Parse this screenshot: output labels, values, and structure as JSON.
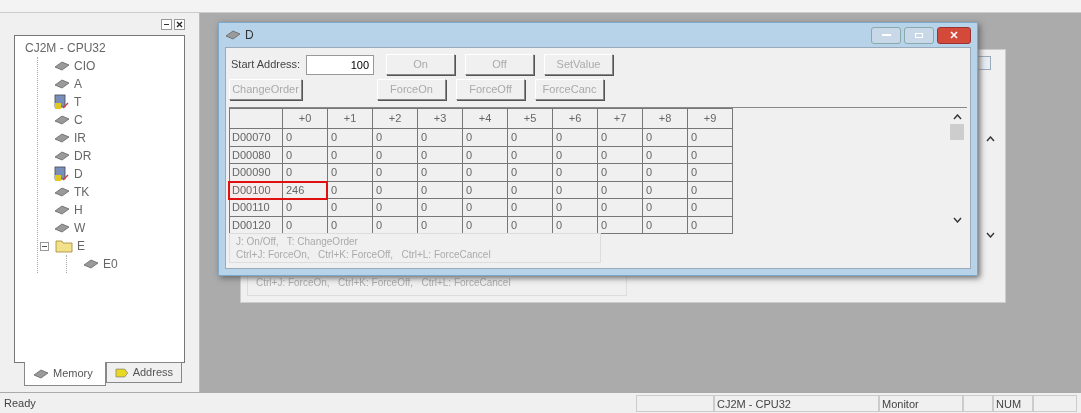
{
  "tree": {
    "label": "CJ2M - CPU32",
    "children": [
      {
        "label": "CIO",
        "kind": "area"
      },
      {
        "label": "A",
        "kind": "area"
      },
      {
        "label": "T",
        "kind": "table"
      },
      {
        "label": "C",
        "kind": "area"
      },
      {
        "label": "IR",
        "kind": "area"
      },
      {
        "label": "DR",
        "kind": "area"
      },
      {
        "label": "D",
        "kind": "table"
      },
      {
        "label": "TK",
        "kind": "area"
      },
      {
        "label": "H",
        "kind": "area"
      },
      {
        "label": "W",
        "kind": "area"
      },
      {
        "label": "E",
        "kind": "folder",
        "expanded": true,
        "children": [
          {
            "label": "E0",
            "kind": "area"
          }
        ]
      }
    ]
  },
  "pane_tabs": [
    {
      "label": "Memory",
      "selected": true
    },
    {
      "label": "Address",
      "selected": false
    }
  ],
  "back_window": {
    "hint": "Ctrl+J: ForceOn,   Ctrl+K: ForceOff,   Ctrl+L: ForceCancel"
  },
  "window": {
    "title": "D",
    "start_address_label": "Start Address:",
    "start_address": "100",
    "buttons_row_1": [
      {
        "label": "On",
        "disabled": true
      },
      {
        "label": "Off",
        "disabled": true
      },
      {
        "label": "SetValue",
        "disabled": true
      }
    ],
    "change_order": {
      "label": "ChangeOrder",
      "disabled": true
    },
    "buttons_row_2": [
      {
        "label": "ForceOn",
        "disabled": true
      },
      {
        "label": "ForceOff",
        "disabled": true
      },
      {
        "label": "ForceCanc",
        "disabled": true
      }
    ],
    "table": {
      "columns": [
        "+0",
        "+1",
        "+2",
        "+3",
        "+4",
        "+5",
        "+6",
        "+7",
        "+8",
        "+9"
      ],
      "rows": [
        {
          "address": "D00070",
          "highlighted": false,
          "values": [
            "0",
            "0",
            "0",
            "0",
            "0",
            "0",
            "0",
            "0",
            "0",
            "0"
          ]
        },
        {
          "address": "D00080",
          "highlighted": false,
          "values": [
            "0",
            "0",
            "0",
            "0",
            "0",
            "0",
            "0",
            "0",
            "0",
            "0"
          ]
        },
        {
          "address": "D00090",
          "highlighted": false,
          "values": [
            "0",
            "0",
            "0",
            "0",
            "0",
            "0",
            "0",
            "0",
            "0",
            "0"
          ]
        },
        {
          "address": "D00100",
          "highlighted": true,
          "values": [
            "246",
            "0",
            "0",
            "0",
            "0",
            "0",
            "0",
            "0",
            "0",
            "0"
          ]
        },
        {
          "address": "D00110",
          "highlighted": false,
          "values": [
            "0",
            "0",
            "0",
            "0",
            "0",
            "0",
            "0",
            "0",
            "0",
            "0"
          ]
        },
        {
          "address": "D00120",
          "highlighted": false,
          "values": [
            "0",
            "0",
            "0",
            "0",
            "0",
            "0",
            "0",
            "0",
            "0",
            "0"
          ]
        }
      ]
    },
    "hints": [
      "J: On/Off,   T: ChangeOrder",
      "Ctrl+J: ForceOn,   Ctrl+K: ForceOff,   Ctrl+L: ForceCancel"
    ]
  },
  "status_bar": [
    "Ready",
    "CJ2M - CPU32",
    "Monitor",
    "NUM"
  ]
}
